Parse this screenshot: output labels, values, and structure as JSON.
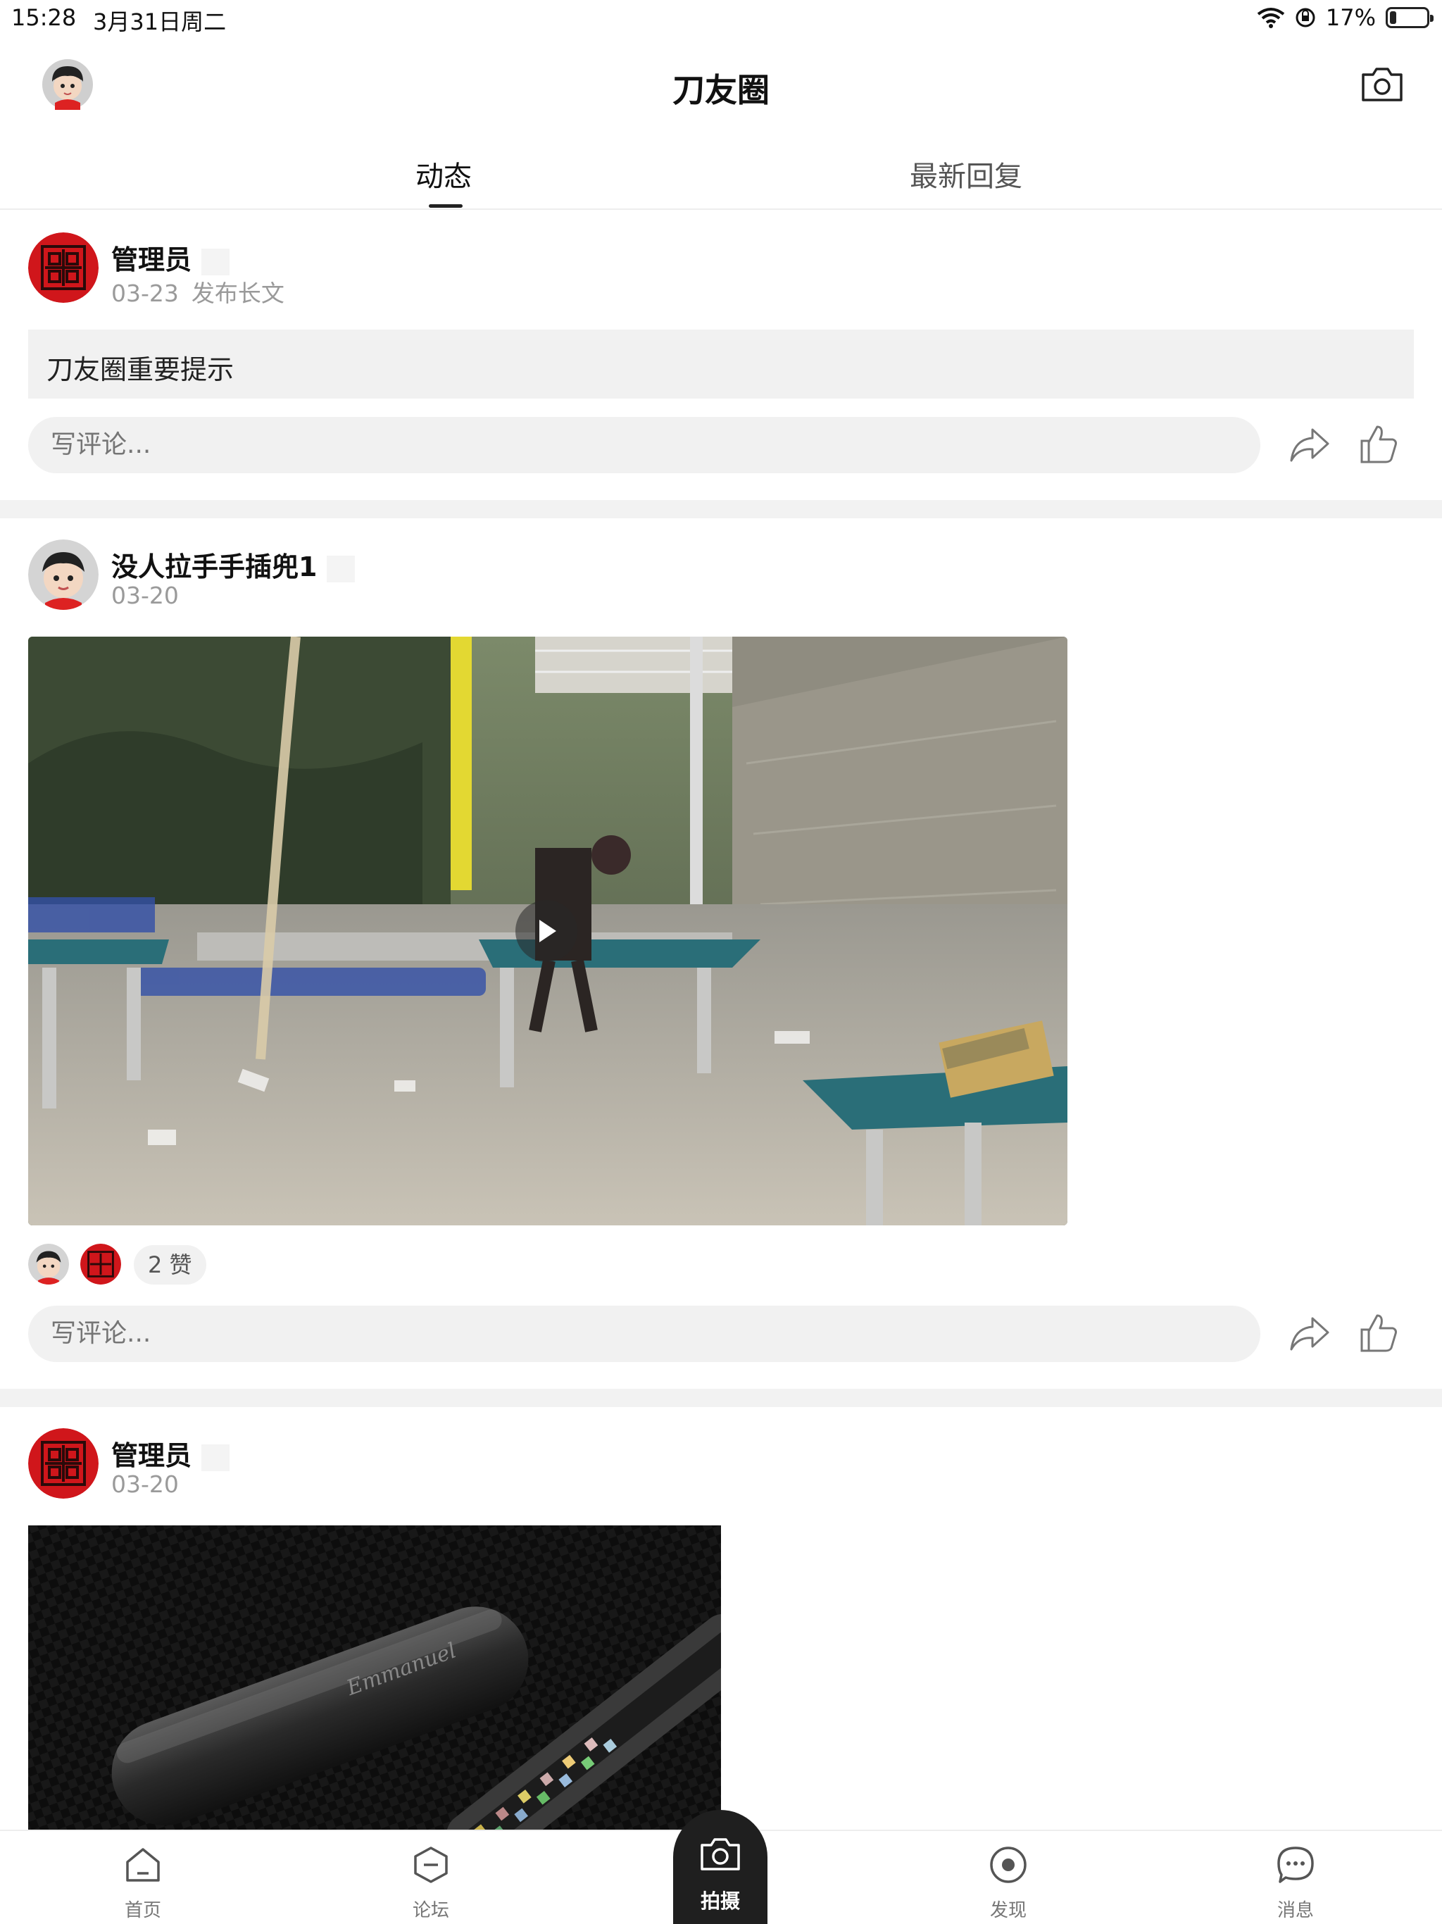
{
  "status_bar": {
    "time": "15:28",
    "date": "3月31日周二",
    "battery_percent": "17%",
    "battery_level": 0.17
  },
  "header": {
    "title": "刀友圈"
  },
  "tabs": [
    {
      "label": "动态",
      "active": true
    },
    {
      "label": "最新回复",
      "active": false
    }
  ],
  "posts": [
    {
      "author": "管理员",
      "date": "03-23",
      "action": "发布长文",
      "long_title": "刀友圈重要提示",
      "comment_placeholder": "写评论..."
    },
    {
      "author": "没人拉手手插兜1",
      "date": "03-20",
      "likes_label": "2 赞",
      "comment_placeholder": "写评论..."
    },
    {
      "author": "管理员",
      "date": "03-20"
    }
  ],
  "bottom_nav": [
    {
      "label": "首页",
      "icon": "home-icon"
    },
    {
      "label": "论坛",
      "icon": "forum-icon"
    },
    {
      "label": "拍摄",
      "icon": "camera-icon"
    },
    {
      "label": "发现",
      "icon": "discover-icon"
    },
    {
      "label": "消息",
      "icon": "messages-icon"
    }
  ],
  "colors": {
    "accent": "#1f1f1f",
    "seal_red": "#d0161b",
    "separator": "#f2f2f2",
    "input_bg": "#f1f1f1"
  }
}
